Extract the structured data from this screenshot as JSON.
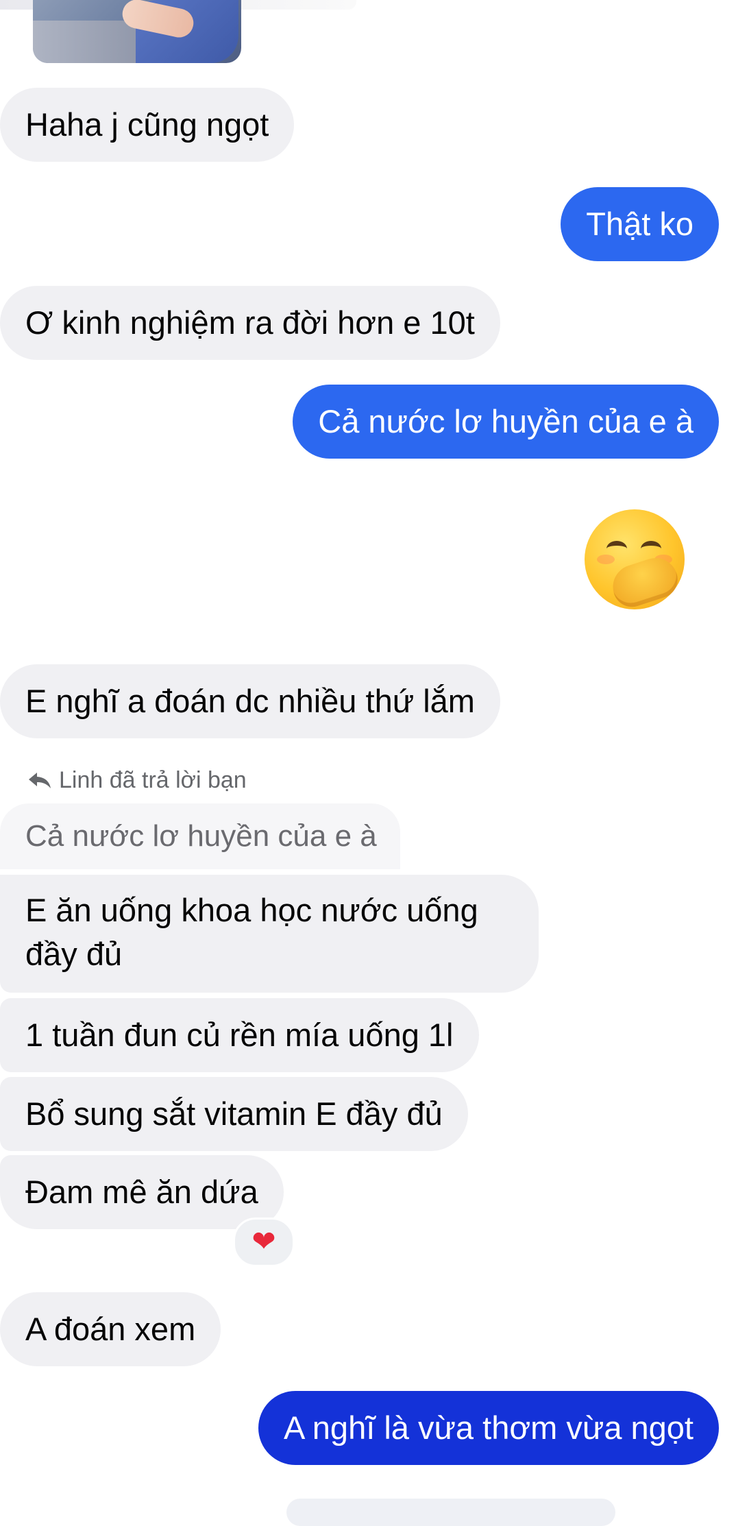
{
  "messages": [
    {
      "id": "m1",
      "side": "in",
      "text": "Haha j cũng ngọt"
    },
    {
      "id": "m2",
      "side": "out",
      "text": "Thật ko"
    },
    {
      "id": "m3",
      "side": "in",
      "text": "Ơ kinh nghiệm ra đời hơn e 10t"
    },
    {
      "id": "m4",
      "side": "out",
      "text": "Cả nước lơ huyền của e à"
    },
    {
      "id": "m5",
      "side": "out",
      "emoji": "face-with-hand-over-mouth"
    },
    {
      "id": "m6",
      "side": "in",
      "text": "E nghĩ a đoán dc nhiều thứ lắm"
    },
    {
      "id": "m7",
      "side": "in",
      "text": "E ăn uống khoa học nước uống đầy đủ",
      "lines": [
        "E ăn uống khoa học nước uống",
        "đầy đủ"
      ]
    },
    {
      "id": "m8",
      "side": "in",
      "text": "1 tuần đun củ rền mía uống 1l"
    },
    {
      "id": "m9",
      "side": "in",
      "text": "Bổ sung sắt vitamin E đầy đủ"
    },
    {
      "id": "m10",
      "side": "in",
      "text": "Đam mê ăn dứa",
      "reaction": "❤️"
    },
    {
      "id": "m11",
      "side": "in",
      "text": "A đoán xem"
    },
    {
      "id": "m12",
      "side": "out",
      "text": "A nghĩ là vừa thơm vừa ngọt"
    }
  ],
  "reply": {
    "label": "Linh đã trả lời bạn",
    "quoted": "Cả nước lơ huyền của e à",
    "icon": "reply-arrow-icon"
  },
  "reaction": {
    "symbol": "❤",
    "color": "#e8283a"
  },
  "colors": {
    "incoming_bubble": "#f0f0f3",
    "outgoing_bubble": "#2c68f0",
    "outgoing_bubble_latest": "#1432d8",
    "background": "#ffffff"
  }
}
